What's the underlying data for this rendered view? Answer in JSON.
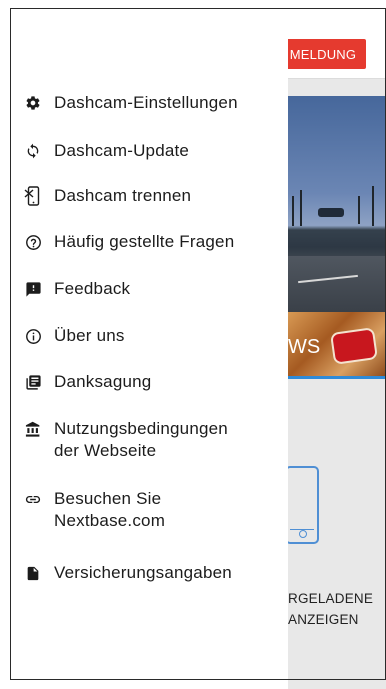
{
  "header": {
    "login_label": "MELDUNG"
  },
  "background": {
    "news_label": "WS",
    "maps_label": "RGELADENE\nANZEIGEN"
  },
  "menu": {
    "items": [
      {
        "label": "Dashcam-Einstellungen",
        "icon": "gear-icon"
      },
      {
        "label": "Dashcam-Update",
        "icon": "refresh-icon"
      },
      {
        "label": "Dashcam trennen",
        "icon": "disconnect-phone-icon"
      },
      {
        "label": "Häufig gestellte Fragen",
        "icon": "help-circle-icon"
      },
      {
        "label": "Feedback",
        "icon": "feedback-icon"
      },
      {
        "label": "Über uns",
        "icon": "info-icon"
      },
      {
        "label": "Danksagung",
        "icon": "document-list-icon"
      },
      {
        "label": "Nutzungsbedingungen\nder Webseite",
        "icon": "institution-icon"
      },
      {
        "label": "Besuchen Sie\nNextbase.com",
        "icon": "link-icon"
      },
      {
        "label": "Versicherungsangaben",
        "icon": "file-icon"
      }
    ]
  },
  "colors": {
    "accent_red": "#e53a2f",
    "accent_blue": "#4f8fd4"
  }
}
